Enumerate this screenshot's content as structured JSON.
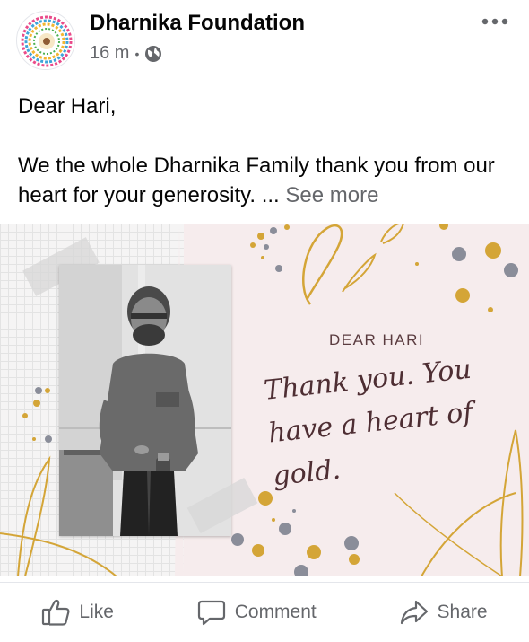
{
  "post": {
    "page_name": "Dharnika Foundation",
    "time": "16 m",
    "separator": "•",
    "privacy_icon": "globe-icon",
    "more_icon": "more-horizontal-icon",
    "text_line1": "Dear Hari,",
    "text_line2": "We the whole Dharnika Family thank you from our heart for your generosity. ...",
    "see_more": "See more"
  },
  "card": {
    "greeting": "DEAR HARI",
    "script_text": "Thank you. You have a heart of gold.",
    "colors": {
      "background": "#f6eced",
      "gold": "#d4a537",
      "gray": "#8a8d99"
    }
  },
  "actions": {
    "like": "Like",
    "comment": "Comment",
    "share": "Share"
  }
}
